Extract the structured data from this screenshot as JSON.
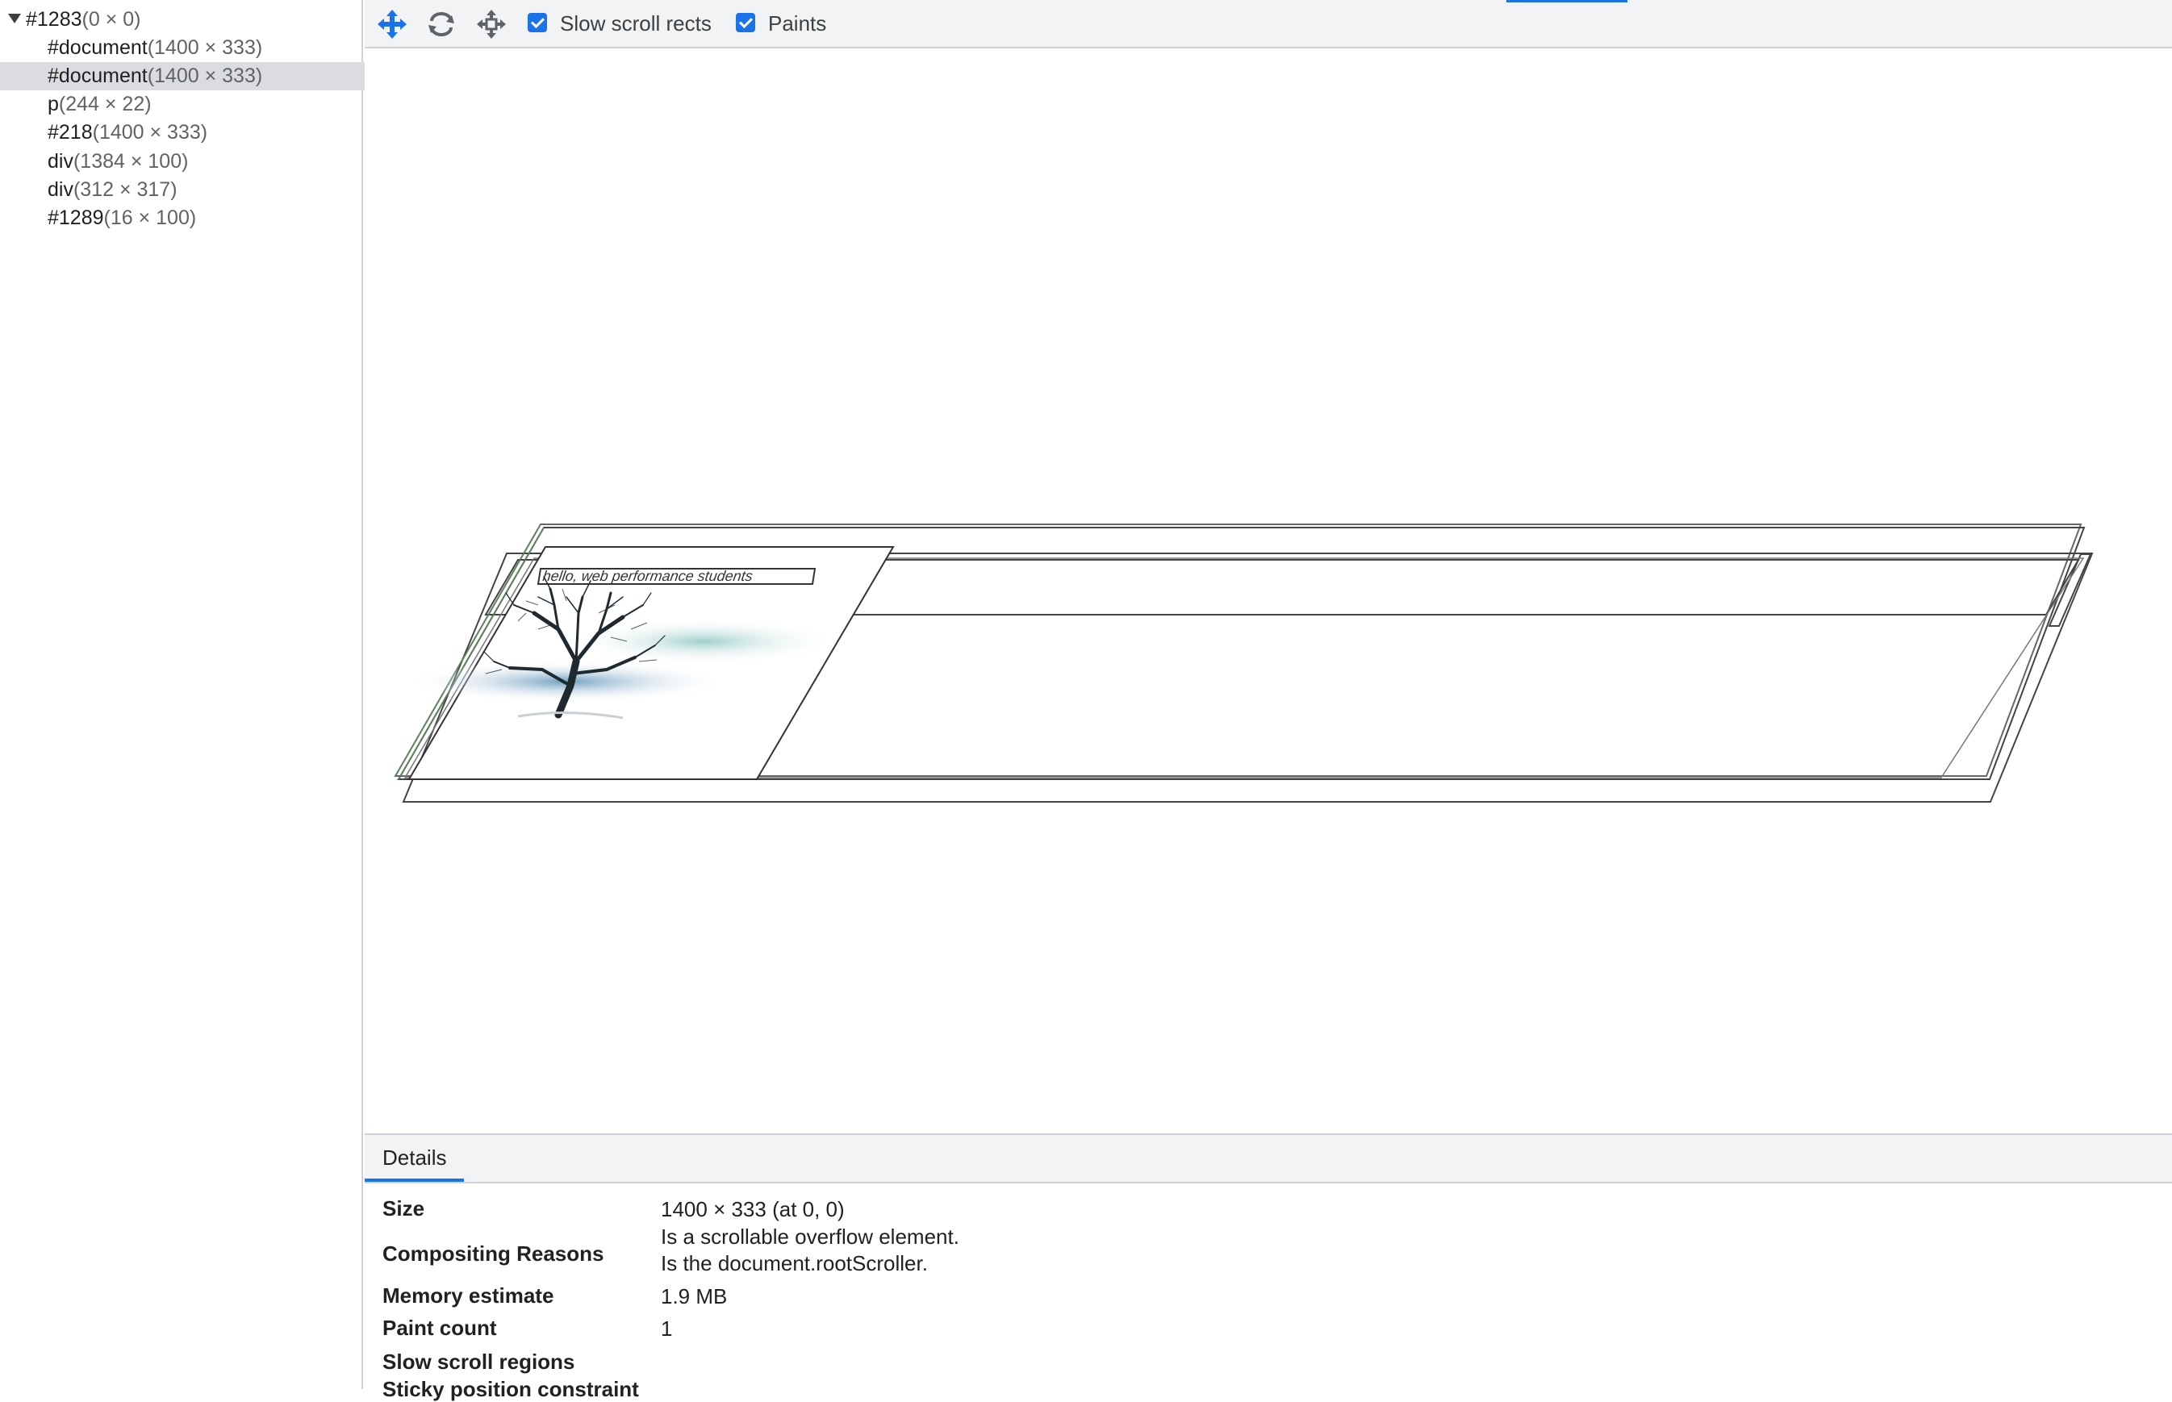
{
  "tree": {
    "items": [
      {
        "name": "#1283",
        "dims": "(0 × 0)",
        "level": 0,
        "expanded": true,
        "selected": false
      },
      {
        "name": "#document",
        "dims": "(1400 × 333)",
        "level": 1,
        "selected": false
      },
      {
        "name": "#document",
        "dims": "(1400 × 333)",
        "level": 1,
        "selected": true
      },
      {
        "name": "p",
        "dims": "(244 × 22)",
        "level": 1,
        "selected": false
      },
      {
        "name": "#218",
        "dims": "(1400 × 333)",
        "level": 1,
        "selected": false
      },
      {
        "name": "div",
        "dims": "(1384 × 100)",
        "level": 1,
        "selected": false
      },
      {
        "name": "div",
        "dims": "(312 × 317)",
        "level": 1,
        "selected": false
      },
      {
        "name": "#1289",
        "dims": "(16 × 100)",
        "level": 1,
        "selected": false
      }
    ]
  },
  "toolbar": {
    "pan_icon": "pan-mode-icon",
    "rotate_icon": "rotate-mode-icon",
    "reset_icon": "reset-view-icon",
    "slow_scroll_label": "Slow scroll rects",
    "slow_scroll_checked": true,
    "paints_label": "Paints",
    "paints_checked": true,
    "accent": "#1a73e8"
  },
  "canvas": {
    "layer_text": "hello, web performance students",
    "image": "tree-with-clouds-image"
  },
  "details": {
    "tab_label": "Details",
    "rows": [
      {
        "key": "Size",
        "value": [
          "1400 × 333 (at 0, 0)"
        ]
      },
      {
        "key": "Compositing Reasons",
        "value": [
          "Is a scrollable overflow element.",
          "Is the document.rootScroller."
        ]
      },
      {
        "key": "Memory estimate",
        "value": [
          "1.9 MB"
        ]
      },
      {
        "key": "Paint count",
        "value": [
          "1"
        ]
      },
      {
        "key": "Slow scroll regions",
        "value": []
      },
      {
        "key": "Sticky position constraint",
        "value": []
      }
    ]
  }
}
